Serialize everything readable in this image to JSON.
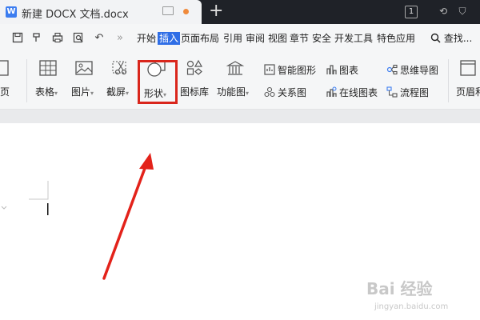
{
  "titlebar": {
    "doc_icon": "W",
    "doc_title": "新建 DOCX 文档.docx",
    "new_tab": "+",
    "window_count": "1",
    "icons": [
      "monitor-icon",
      "modified-dot-icon",
      "badge-icon",
      "history-icon",
      "shirt-icon"
    ]
  },
  "menubar": {
    "items": [
      "开始",
      "插入",
      "页面布局",
      "引用",
      "审阅",
      "视图",
      "章节",
      "安全",
      "开发工具",
      "特色应用"
    ],
    "active": "插入",
    "more": "»",
    "search_label": "查找..."
  },
  "toolbar": {
    "page_partial": "页",
    "table_label": "表格",
    "picture_label": "图片",
    "screenshot_label": "截屏",
    "shape_label": "形状",
    "icon_library_label": "图标库",
    "function_chart_label": "功能图",
    "smart_shape_label": "智能图形",
    "chart_label": "图表",
    "mind_map_label": "思维导图",
    "relation_label": "关系图",
    "online_chart_label": "在线图表",
    "flow_chart_label": "流程图",
    "header_footer_label": "页眉和",
    "dropdown_glyph": "▾"
  },
  "colors": {
    "highlight": "#d9261c",
    "accent": "#2f6ee6",
    "annotation_arrow": "#e3221a"
  },
  "watermark": {
    "main": "Bai 经验",
    "sub": "jingyan.baidu.com"
  }
}
